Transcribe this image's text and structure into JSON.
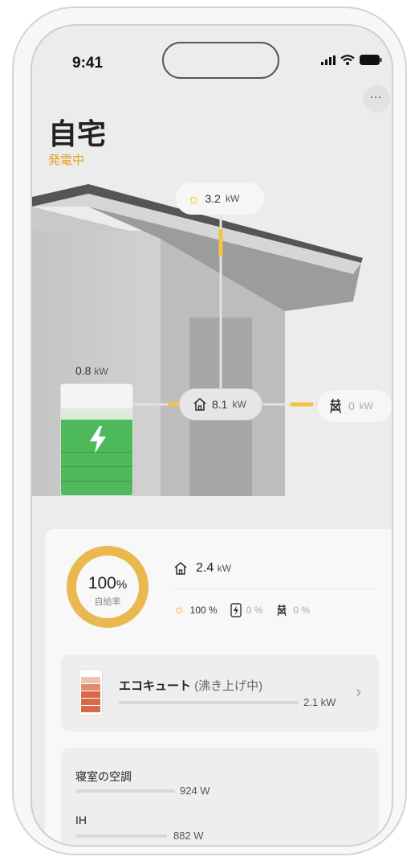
{
  "status_bar": {
    "time": "9:41"
  },
  "header": {
    "title": "自宅",
    "subtitle": "発電中",
    "more_label": "···"
  },
  "flow": {
    "solar": {
      "value": "3.2",
      "unit": "kW"
    },
    "home": {
      "value": "8.1",
      "unit": "kW"
    },
    "grid": {
      "value": "0",
      "unit": "kW"
    },
    "battery": {
      "value": "0.8",
      "unit": "kW",
      "charge_fraction": 0.85
    }
  },
  "summary": {
    "self_sufficiency": {
      "value": "100",
      "unit": "%",
      "label": "自給率",
      "fraction": 1.0
    },
    "usage": {
      "value": "2.4",
      "unit": "kW"
    },
    "ratios": {
      "solar": "100 %",
      "battery": "0 %",
      "grid": "0 %"
    }
  },
  "ecocute": {
    "name": "エコキュート",
    "status": "(沸き上げ中)",
    "value": "2.1 kW",
    "level_fraction": 0.6
  },
  "devices": [
    {
      "name": "寝室の空調",
      "value": "924 W"
    },
    {
      "name": "IH",
      "value": "882 W"
    }
  ],
  "colors": {
    "accent_orange": "#e8a020",
    "solar_yellow": "#f5c242",
    "battery_green": "#4fba5c",
    "ring_gold": "#e9b84e",
    "ecocute_red": "#d9694a"
  }
}
